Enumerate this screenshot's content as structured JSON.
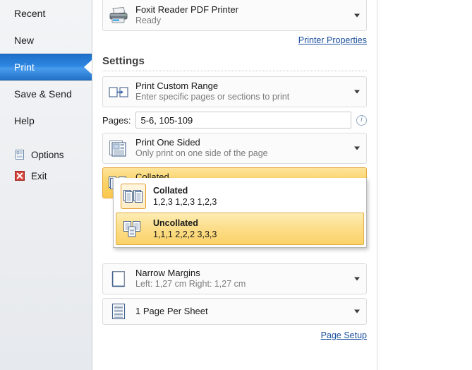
{
  "sidebar": {
    "items": [
      {
        "label": "Recent",
        "active": false
      },
      {
        "label": "New",
        "active": false
      },
      {
        "label": "Print",
        "active": true
      },
      {
        "label": "Save & Send",
        "active": false
      },
      {
        "label": "Help",
        "active": false
      }
    ],
    "commands": [
      {
        "label": "Options",
        "icon": "options-icon"
      },
      {
        "label": "Exit",
        "icon": "exit-icon"
      }
    ]
  },
  "printer": {
    "name": "Foxit Reader PDF Printer",
    "status": "Ready",
    "icon": "printer-icon",
    "properties_link": "Printer Properties"
  },
  "settings": {
    "heading": "Settings",
    "range": {
      "title": "Print Custom Range",
      "subtitle": "Enter specific pages or sections to print",
      "icon": "custom-range-icon"
    },
    "pages": {
      "label": "Pages:",
      "value": "5-6, 105-109",
      "placeholder": "",
      "info_icon": "info-icon"
    },
    "sides": {
      "title": "Print One Sided",
      "subtitle": "Only print on one side of the page",
      "icon": "one-sided-icon"
    },
    "collation": {
      "title": "Collated",
      "subtitle": "1,2,3   1,2,3   1,2,3",
      "icon": "collated-icon",
      "open": true,
      "options": [
        {
          "title": "Collated",
          "subtitle": "1,2,3   1,2,3   1,2,3",
          "icon": "collated-icon",
          "current": true,
          "hovered": false
        },
        {
          "title": "Uncollated",
          "subtitle": "1,1,1   2,2,2   3,3,3",
          "icon": "uncollated-icon",
          "current": false,
          "hovered": true
        }
      ]
    },
    "margins": {
      "title": "Narrow Margins",
      "subtitle": "Left: 1,27 cm   Right: 1,27 cm",
      "icon": "margins-icon"
    },
    "pages_per_sheet": {
      "title": "1 Page Per Sheet",
      "subtitle": "",
      "icon": "page-per-sheet-icon"
    },
    "page_setup_link": "Page Setup"
  },
  "colors": {
    "accent_blue": "#2e86e0",
    "highlight_yellow": "#fbd469",
    "highlight_border": "#e3a33a",
    "link_blue": "#1a4f9c",
    "sidebar_bg": "#eceef1"
  }
}
